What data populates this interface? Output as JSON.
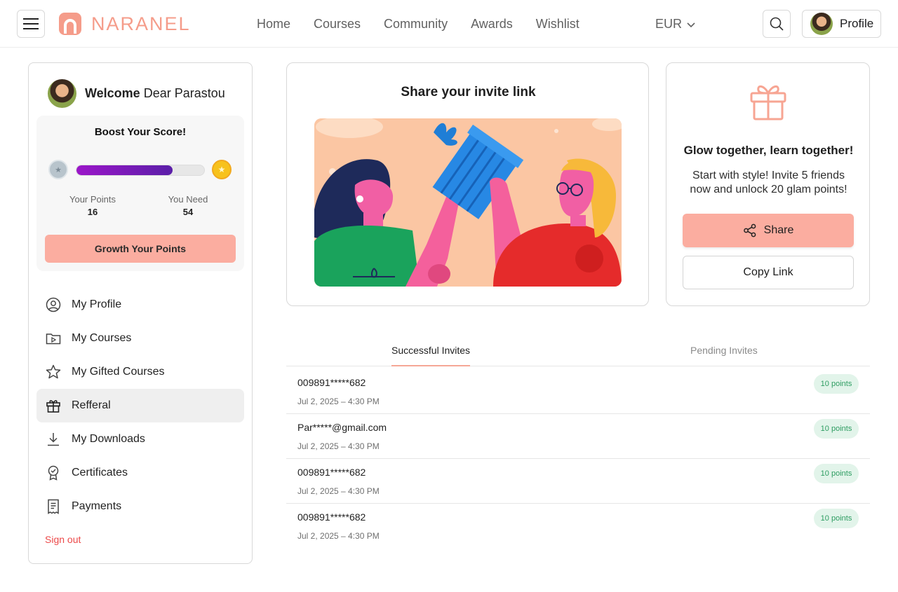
{
  "header": {
    "brand": "NARANEL",
    "nav": [
      "Home",
      "Courses",
      "Community",
      "Awards",
      "Wishlist"
    ],
    "currency": "EUR",
    "profile_label": "Profile"
  },
  "sidebar": {
    "welcome_bold": "Welcome",
    "welcome_name": " Dear Parastou",
    "boost": {
      "title": "Boost Your Score!",
      "progress_fraction": 0.75,
      "your_points_label": "Your Points",
      "your_points_value": "16",
      "you_need_label": "You Need",
      "you_need_value": "54",
      "button_label": "Growth Your Points"
    },
    "items": [
      {
        "label": "My Profile",
        "icon": "user-circle-icon"
      },
      {
        "label": "My Courses",
        "icon": "folder-play-icon"
      },
      {
        "label": "My Gifted Courses",
        "icon": "star-icon"
      },
      {
        "label": "Refferal",
        "icon": "gift-icon"
      },
      {
        "label": "My Downloads",
        "icon": "download-icon"
      },
      {
        "label": "Certificates",
        "icon": "certificate-icon"
      },
      {
        "label": "Payments",
        "icon": "receipt-icon"
      }
    ],
    "active_item": "Refferal",
    "signout": "Sign out"
  },
  "invite": {
    "title": "Share your invite link"
  },
  "share": {
    "heading": "Glow together, learn together!",
    "subtext": "Start with style! Invite 5 friends now and unlock 20 glam points!",
    "share_label": "Share",
    "copy_label": "Copy Link"
  },
  "tabs": {
    "successful": "Successful Invites",
    "pending": "Pending Invites"
  },
  "invites": [
    {
      "who": "009891*****682",
      "when": "Jul 2, 2025 – 4:30 PM",
      "points": "10 points"
    },
    {
      "who": "Par*****@gmail.com",
      "when": "Jul 2, 2025 – 4:30 PM",
      "points": "10 points"
    },
    {
      "who": "009891*****682",
      "when": "Jul 2, 2025 – 4:30 PM",
      "points": "10 points"
    },
    {
      "who": "009891*****682",
      "when": "Jul 2, 2025 – 4:30 PM",
      "points": "10 points"
    }
  ],
  "colors": {
    "accent": "#fbada0",
    "brand": "#f59c8a",
    "signout": "#ec4a4a",
    "badge_bg": "#e2f4ea",
    "badge_text": "#2e9d62"
  }
}
